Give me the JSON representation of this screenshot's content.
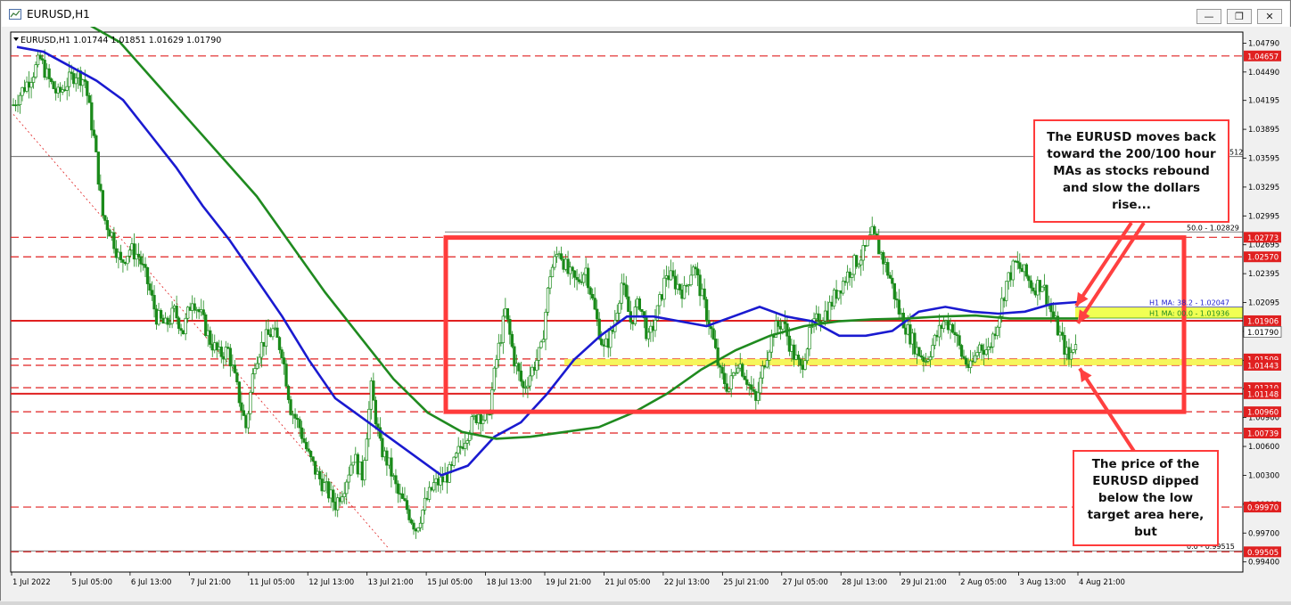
{
  "window": {
    "title": "EURUSD,H1",
    "minimize_icon": "minimize-icon",
    "restore_icon": "restore-icon",
    "close_icon": "close-icon"
  },
  "chart_data": {
    "type": "line",
    "header": "EURUSD,H1  1.01744 1.01851 1.01629 1.01790",
    "ylim": [
      0.99295,
      1.04905
    ],
    "price_ticks": [
      "1.04790",
      "1.04490",
      "1.04195",
      "1.03895",
      "1.03595",
      "1.03295",
      "1.02995",
      "1.02695",
      "1.02395",
      "1.02095",
      "1.01795",
      "1.01495",
      "1.01200",
      "1.00900",
      "1.00600",
      "1.00300",
      "1.00000",
      "0.99700",
      "0.99400"
    ],
    "time_labels": [
      "1 Jul 2022",
      "5 Jul 05:00",
      "6 Jul 13:00",
      "7 Jul 21:00",
      "11 Jul 05:00",
      "12 Jul 13:00",
      "13 Jul 21:00",
      "15 Jul 05:00",
      "18 Jul 13:00",
      "19 Jul 21:00",
      "21 Jul 05:00",
      "22 Jul 13:00",
      "25 Jul 21:00",
      "27 Jul 05:00",
      "28 Jul 13:00",
      "29 Jul 21:00",
      "2 Aug 05:00",
      "3 Aug 13:00",
      "4 Aug 21:00"
    ],
    "levels": [
      {
        "label": "1.04657",
        "value": 1.04657,
        "style": "dashed"
      },
      {
        "label": "1.02773",
        "value": 1.02773,
        "style": "dashed"
      },
      {
        "label": "1.02570",
        "value": 1.0257,
        "style": "dashed"
      },
      {
        "label": "1.01906",
        "value": 1.01906,
        "style": "solid"
      },
      {
        "label": "1.01509",
        "value": 1.01509,
        "style": "dashed"
      },
      {
        "label": "1.01443",
        "value": 1.01443,
        "style": "dashed"
      },
      {
        "label": "1.01210",
        "value": 1.0121,
        "style": "dashed"
      },
      {
        "label": "1.01148",
        "value": 1.01148,
        "style": "solid"
      },
      {
        "label": "1.00960",
        "value": 1.0096,
        "style": "dashed"
      },
      {
        "label": "1.00739",
        "value": 1.00739,
        "style": "dashed"
      },
      {
        "label": "0.99970",
        "value": 0.9997,
        "style": "dashed"
      },
      {
        "label": "0.99505",
        "value": 0.99505,
        "style": "dashed"
      }
    ],
    "current_price": {
      "label": "1.01790",
      "value": 1.0179
    },
    "fib_labels": [
      {
        "text": "50.0 - 1.02829",
        "value": 1.02829
      },
      {
        "text": "0.0 - 0.99515",
        "value": 0.99515
      },
      {
        "text": "512",
        "value": 1.03612
      }
    ],
    "ma_labels": [
      {
        "text": "H1 MA: 38.2 - 1.02047",
        "value": 1.02047
      },
      {
        "text": "H1 MA: 00.0 - 1.01936",
        "value": 1.01936
      }
    ],
    "price_series": [
      1.0415,
      1.043,
      1.0445,
      1.0462,
      1.044,
      1.0425,
      1.0438,
      1.0448,
      1.044,
      1.038,
      1.03,
      1.028,
      1.025,
      1.0265,
      1.0258,
      1.023,
      1.0195,
      1.0185,
      1.02,
      1.018,
      1.0215,
      1.0195,
      1.017,
      1.0155,
      1.016,
      1.012,
      1.008,
      1.015,
      1.017,
      1.018,
      1.016,
      1.01,
      1.008,
      1.005,
      1.003,
      1.0015,
      1.0,
      1.002,
      1.005,
      1.003,
      1.012,
      1.006,
      1.004,
      1.001,
      0.9995,
      0.9975,
      1.0,
      1.002,
      1.0025,
      1.0035,
      1.006,
      1.008,
      1.0095,
      1.0085,
      1.015,
      1.02,
      1.015,
      1.012,
      1.014,
      1.016,
      1.024,
      1.0265,
      1.024,
      1.023,
      1.0245,
      1.02,
      1.016,
      1.018,
      1.023,
      1.019,
      1.021,
      1.017,
      1.02,
      1.024,
      1.023,
      1.022,
      1.025,
      1.0215,
      1.018,
      1.0135,
      1.012,
      1.015,
      1.013,
      1.0105,
      1.015,
      1.018,
      1.019,
      1.016,
      1.014,
      1.0175,
      1.0195,
      1.02,
      1.022,
      1.0235,
      1.025,
      1.026,
      1.028,
      1.026,
      1.0235,
      1.02,
      1.018,
      1.016,
      1.015,
      1.017,
      1.019,
      1.0185,
      1.0155,
      1.014,
      1.0165,
      1.016,
      1.019,
      1.023,
      1.025,
      1.024,
      1.0225,
      1.023,
      1.02,
      1.0175,
      1.015,
      1.0179
    ],
    "series": [
      {
        "name": "H1 MA 100",
        "color": "#1a1ad0",
        "values": [
          1.0475,
          1.047,
          1.0455,
          1.044,
          1.042,
          1.0385,
          1.035,
          1.031,
          1.0275,
          1.0235,
          1.0195,
          1.015,
          1.011,
          1.009,
          1.007,
          1.005,
          1.003,
          1.004,
          1.007,
          1.0085,
          1.0115,
          1.015,
          1.0175,
          1.0195,
          1.0195,
          1.019,
          1.0185,
          1.0195,
          1.0205,
          1.0195,
          1.019,
          1.0175,
          1.0175,
          1.018,
          1.02,
          1.0205,
          1.02,
          1.0198,
          1.02,
          1.0208,
          1.021
        ]
      },
      {
        "name": "H1 MA 200",
        "color": "#1f8a1f",
        "values": [
          1.05,
          1.048,
          1.044,
          1.04,
          1.036,
          1.032,
          1.027,
          1.022,
          1.0175,
          1.013,
          1.0095,
          1.0075,
          1.0068,
          1.007,
          1.0075,
          1.008,
          1.0095,
          1.0115,
          1.014,
          1.016,
          1.0175,
          1.0185,
          1.019,
          1.0192,
          1.0193,
          1.0195,
          1.0196,
          1.0193,
          1.0193,
          1.0193
        ]
      }
    ]
  },
  "callouts": {
    "top": "The EURUSD moves back toward the 200/100 hour MAs as stocks rebound and slow the dollars rise...",
    "bottom": "The price of the EURUSD dipped below the low target area here, but"
  }
}
